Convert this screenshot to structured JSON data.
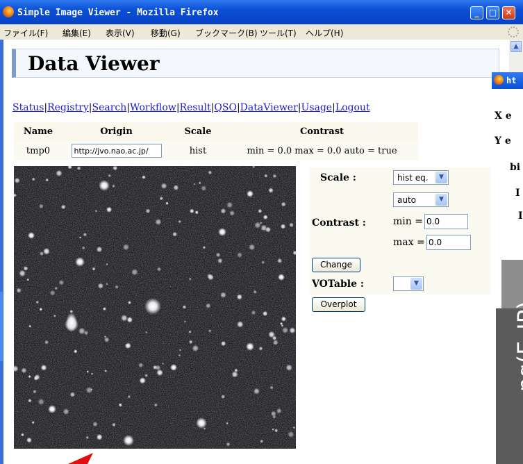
{
  "window": {
    "title": "Simple Image Viewer - Mozilla Firefox",
    "buttons": {
      "minimize": "_",
      "maximize": "□",
      "close": "✕"
    }
  },
  "menu": [
    "ファイル(F)",
    "編集(E)",
    "表示(V)",
    "移動(G)",
    "ブックマーク(B)",
    "ツール(T)",
    "ヘルプ(H)"
  ],
  "page": {
    "heading": "Data Viewer",
    "nav": [
      "Status",
      "Registry",
      "Search",
      "Workflow",
      "Result",
      "QSO",
      "DataViewer",
      "Usage",
      "Logout"
    ],
    "nav_separator": "|"
  },
  "info_table": {
    "headers": [
      "Name",
      "Origin",
      "Scale",
      "Contrast"
    ],
    "row": {
      "name": "tmp0",
      "origin": "http://jvo.nao.ac.jp/",
      "scale": "hist",
      "contrast": "min = 0.0 max = 0.0 auto = true"
    }
  },
  "controls": {
    "scale_label": "Scale :",
    "scale_value": "hist eq.",
    "contrast_label": "Contrast :",
    "contrast_mode": "auto",
    "min_label": "min =",
    "min_value": "0.0",
    "max_label": "max =",
    "max_value": "0.0",
    "change_button": "Change",
    "votable_label": "VOTable :",
    "votable_value": "",
    "overplot_button": "Overplot"
  },
  "popup": {
    "title": "ht",
    "rows": [
      "X e",
      "Y e",
      "bi",
      "I",
      "I"
    ],
    "vertical_text": "ng(E_JP)"
  },
  "colors": {
    "titlebar": "#0a4fd6",
    "link": "#2020cc",
    "menubar": "#ece9d8",
    "image_background": "#1a1a1d"
  }
}
